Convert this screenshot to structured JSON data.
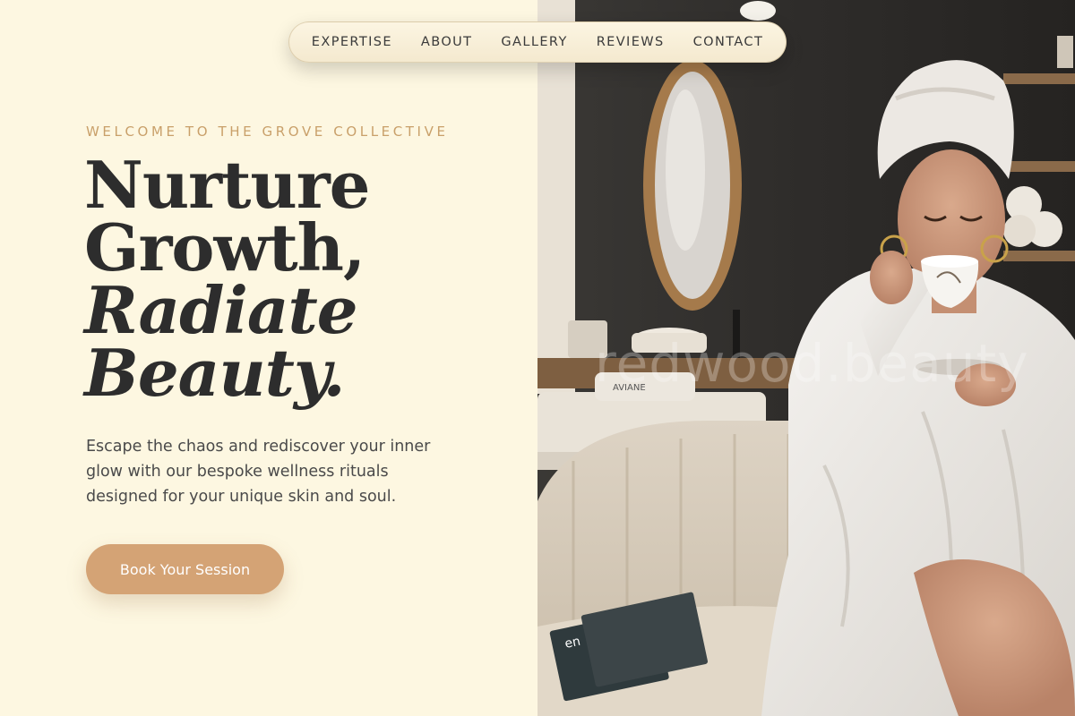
{
  "nav": {
    "items": [
      {
        "label": "EXPERTISE"
      },
      {
        "label": "ABOUT"
      },
      {
        "label": "GALLERY"
      },
      {
        "label": "REVIEWS"
      },
      {
        "label": "CONTACT"
      }
    ]
  },
  "hero": {
    "eyebrow": "WELCOME TO THE GROVE COLLECTIVE",
    "headline": {
      "line1": "Nurture",
      "line2": "Growth,",
      "line3": "Radiate",
      "line4": "Beauty."
    },
    "intro": "Escape the chaos and rediscover your inner glow with our bespoke wellness rituals designed for your unique skin and soul.",
    "cta_label": "Book Your Session"
  },
  "image": {
    "watermark": "redwood.beauty",
    "towel_label": "AVIANE",
    "magazine_label": "en"
  },
  "colors": {
    "background": "#fdf7e1",
    "accent": "#d4a375",
    "eyebrow": "#c9a06a",
    "heading": "#2d2d2d"
  }
}
